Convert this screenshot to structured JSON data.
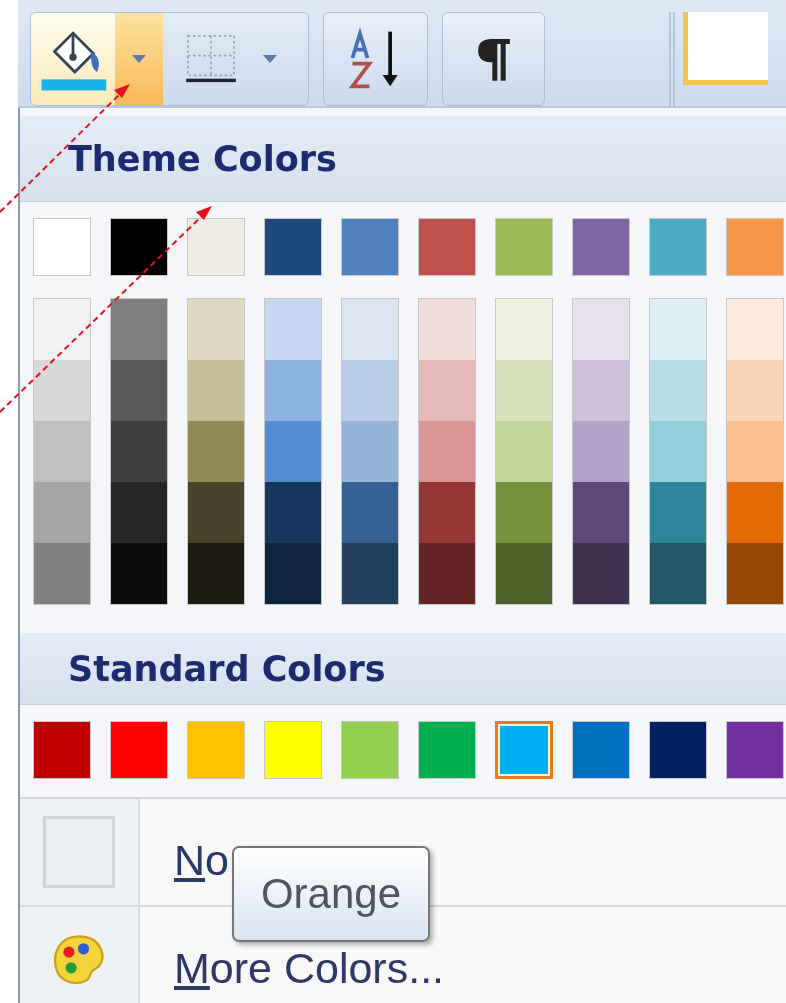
{
  "toolbar": {
    "shading_button": {
      "expanded": true
    }
  },
  "theme_colors": {
    "title": "Theme Colors",
    "base": [
      {
        "color": "#ffffff",
        "selected": false
      },
      {
        "color": "#000000",
        "selected": false
      },
      {
        "color": "#eeece1",
        "selected": false
      },
      {
        "color": "#1f497d",
        "selected": false
      },
      {
        "color": "#4f81bd",
        "selected": false
      },
      {
        "color": "#c0504d",
        "selected": false
      },
      {
        "color": "#9bbb59",
        "selected": false
      },
      {
        "color": "#8064a2",
        "selected": false
      },
      {
        "color": "#4bacc6",
        "selected": false
      },
      {
        "color": "#f79646",
        "selected": false
      }
    ],
    "shades": [
      {
        "cells": [
          {
            "color": "#f2f2f2"
          },
          {
            "color": "#d8d8d8"
          },
          {
            "color": "#bfbfbf"
          },
          {
            "color": "#a5a5a5"
          },
          {
            "color": "#7f7f7f"
          }
        ]
      },
      {
        "cells": [
          {
            "color": "#7f7f7f"
          },
          {
            "color": "#595959"
          },
          {
            "color": "#3f3f3f"
          },
          {
            "color": "#262626"
          },
          {
            "color": "#0c0c0c"
          }
        ]
      },
      {
        "cells": [
          {
            "color": "#ddd9c3"
          },
          {
            "color": "#c4bd97"
          },
          {
            "color": "#938953"
          },
          {
            "color": "#494429"
          },
          {
            "color": "#1d1b10"
          }
        ]
      },
      {
        "cells": [
          {
            "color": "#c6d9f0"
          },
          {
            "color": "#8db3e2"
          },
          {
            "color": "#548dd4"
          },
          {
            "color": "#17365d"
          },
          {
            "color": "#0f243e"
          }
        ]
      },
      {
        "cells": [
          {
            "color": "#dbe5f1"
          },
          {
            "color": "#b8cce4"
          },
          {
            "color": "#95b3d7"
          },
          {
            "color": "#366092"
          },
          {
            "color": "#244061"
          }
        ]
      },
      {
        "cells": [
          {
            "color": "#f2dcdb"
          },
          {
            "color": "#e5b9b7"
          },
          {
            "color": "#d99694"
          },
          {
            "color": "#953734"
          },
          {
            "color": "#632423"
          }
        ]
      },
      {
        "cells": [
          {
            "color": "#ebf1dd"
          },
          {
            "color": "#d7e3bc"
          },
          {
            "color": "#c3d69b"
          },
          {
            "color": "#76923c"
          },
          {
            "color": "#4f6128"
          }
        ]
      },
      {
        "cells": [
          {
            "color": "#e5e0ec"
          },
          {
            "color": "#ccc1d9"
          },
          {
            "color": "#b2a2c7"
          },
          {
            "color": "#5f497a"
          },
          {
            "color": "#3f3151"
          }
        ]
      },
      {
        "cells": [
          {
            "color": "#dbeef3"
          },
          {
            "color": "#b7dde8"
          },
          {
            "color": "#92cddc"
          },
          {
            "color": "#31859b"
          },
          {
            "color": "#205867"
          }
        ]
      },
      {
        "cells": [
          {
            "color": "#fdeada"
          },
          {
            "color": "#fbd5b5"
          },
          {
            "color": "#fac08f"
          },
          {
            "color": "#e36c09"
          },
          {
            "color": "#974806"
          }
        ]
      }
    ]
  },
  "standard_colors": {
    "title": "Standard Colors",
    "swatches": [
      {
        "color": "#c00000",
        "selected": false
      },
      {
        "color": "#ff0000",
        "selected": false
      },
      {
        "color": "#ffc000",
        "selected": false
      },
      {
        "color": "#ffff00",
        "selected": false
      },
      {
        "color": "#92d050",
        "selected": false
      },
      {
        "color": "#00b050",
        "selected": false
      },
      {
        "color": "#00b0f0",
        "selected": true
      },
      {
        "color": "#0070c0",
        "selected": false
      },
      {
        "color": "#002060",
        "selected": false
      },
      {
        "color": "#7030a0",
        "selected": false
      }
    ]
  },
  "menu_items": [
    {
      "kind": "no_color",
      "label": "No"
    },
    {
      "kind": "more_colors",
      "label": "More Colors..."
    }
  ],
  "tooltip": {
    "text": "Orange"
  }
}
